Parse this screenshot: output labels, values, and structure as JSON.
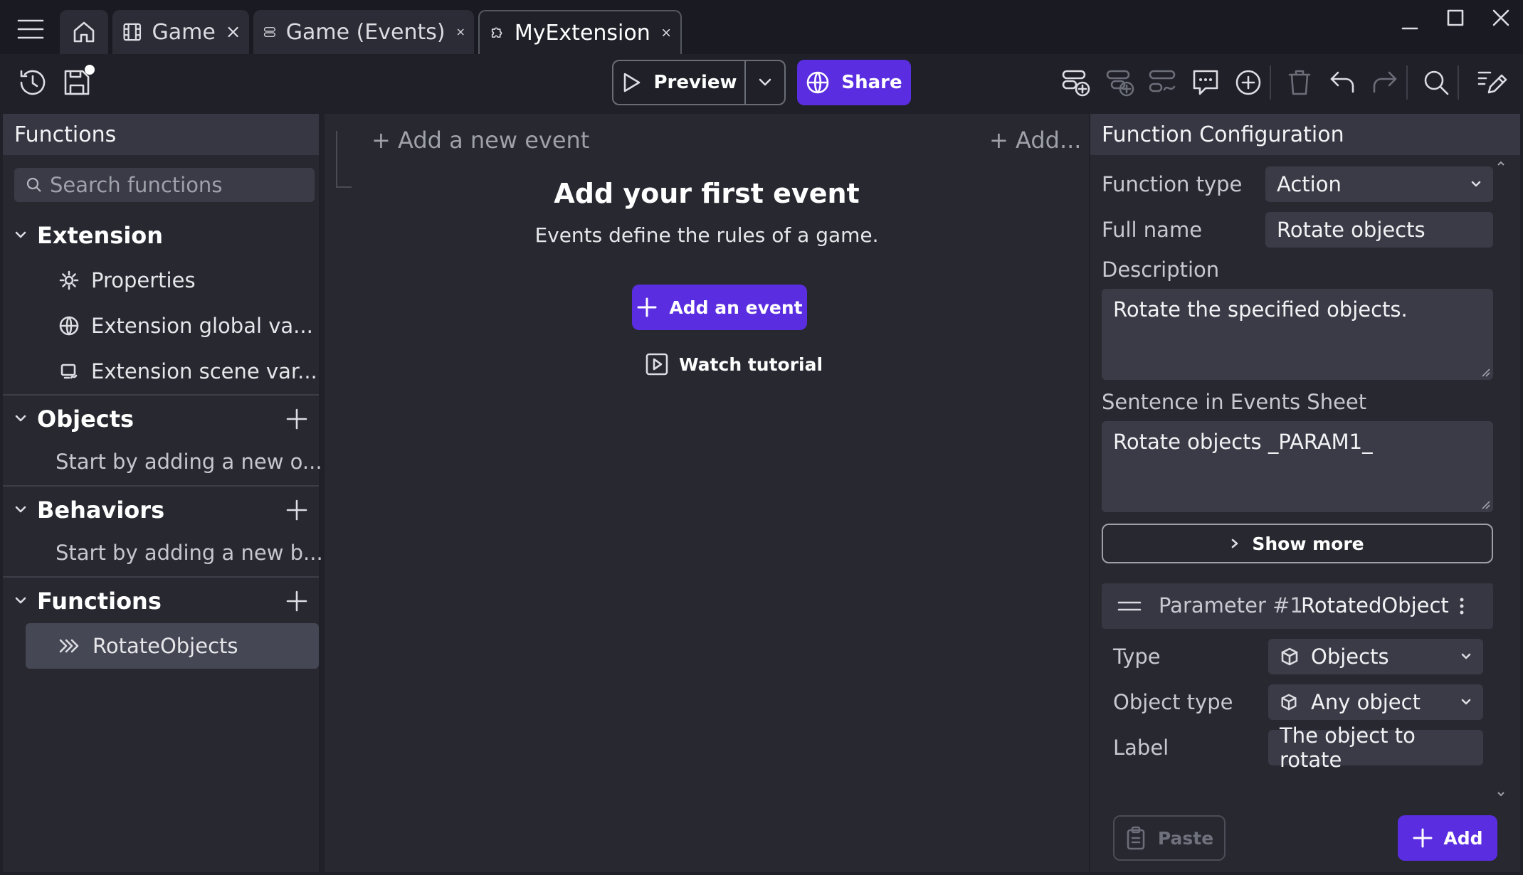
{
  "tabs": [
    {
      "label": "Game",
      "icon": "film-icon"
    },
    {
      "label": "Game (Events)",
      "icon": "list-icon"
    },
    {
      "label": "MyExtension",
      "icon": "puzzle-icon"
    }
  ],
  "toolbar": {
    "preview_label": "Preview",
    "share_label": "Share"
  },
  "left_panel": {
    "title": "Functions",
    "search_placeholder": "Search functions",
    "extension": {
      "heading": "Extension",
      "items": [
        {
          "label": "Properties",
          "icon": "gear-icon"
        },
        {
          "label": "Extension global va...",
          "icon": "globe-icon"
        },
        {
          "label": "Extension scene var...",
          "icon": "scene-variable-icon"
        }
      ]
    },
    "objects": {
      "heading": "Objects",
      "hint": "Start by adding a new o..."
    },
    "behaviors": {
      "heading": "Behaviors",
      "hint": "Start by adding a new b..."
    },
    "functions": {
      "heading": "Functions",
      "items": [
        {
          "label": "RotateObjects",
          "icon": "function-icon"
        }
      ]
    }
  },
  "events": {
    "add_new_event": "+ Add a new event",
    "add_more": "+ Add...",
    "empty_title": "Add your first event",
    "empty_subtitle": "Events define the rules of a game.",
    "add_event_button": "Add an event",
    "watch_tutorial": "Watch tutorial"
  },
  "config": {
    "title": "Function Configuration",
    "function_type_label": "Function type",
    "function_type_value": "Action",
    "full_name_label": "Full name",
    "full_name_value": "Rotate objects",
    "description_label": "Description",
    "description_value": "Rotate the specified objects.",
    "sentence_label": "Sentence in Events Sheet",
    "sentence_value": "Rotate objects _PARAM1_",
    "show_more": "Show more",
    "parameter": {
      "title": "Parameter #1",
      "name": "RotatedObject",
      "type_label": "Type",
      "type_value": "Objects",
      "object_type_label": "Object type",
      "object_type_value": "Any object",
      "label_label": "Label",
      "label_value": "The object to rotate"
    },
    "paste_label": "Paste",
    "add_label": "Add"
  },
  "colors": {
    "accent": "#5a2ee0",
    "background": "#1f2028",
    "panel": "#272830"
  }
}
